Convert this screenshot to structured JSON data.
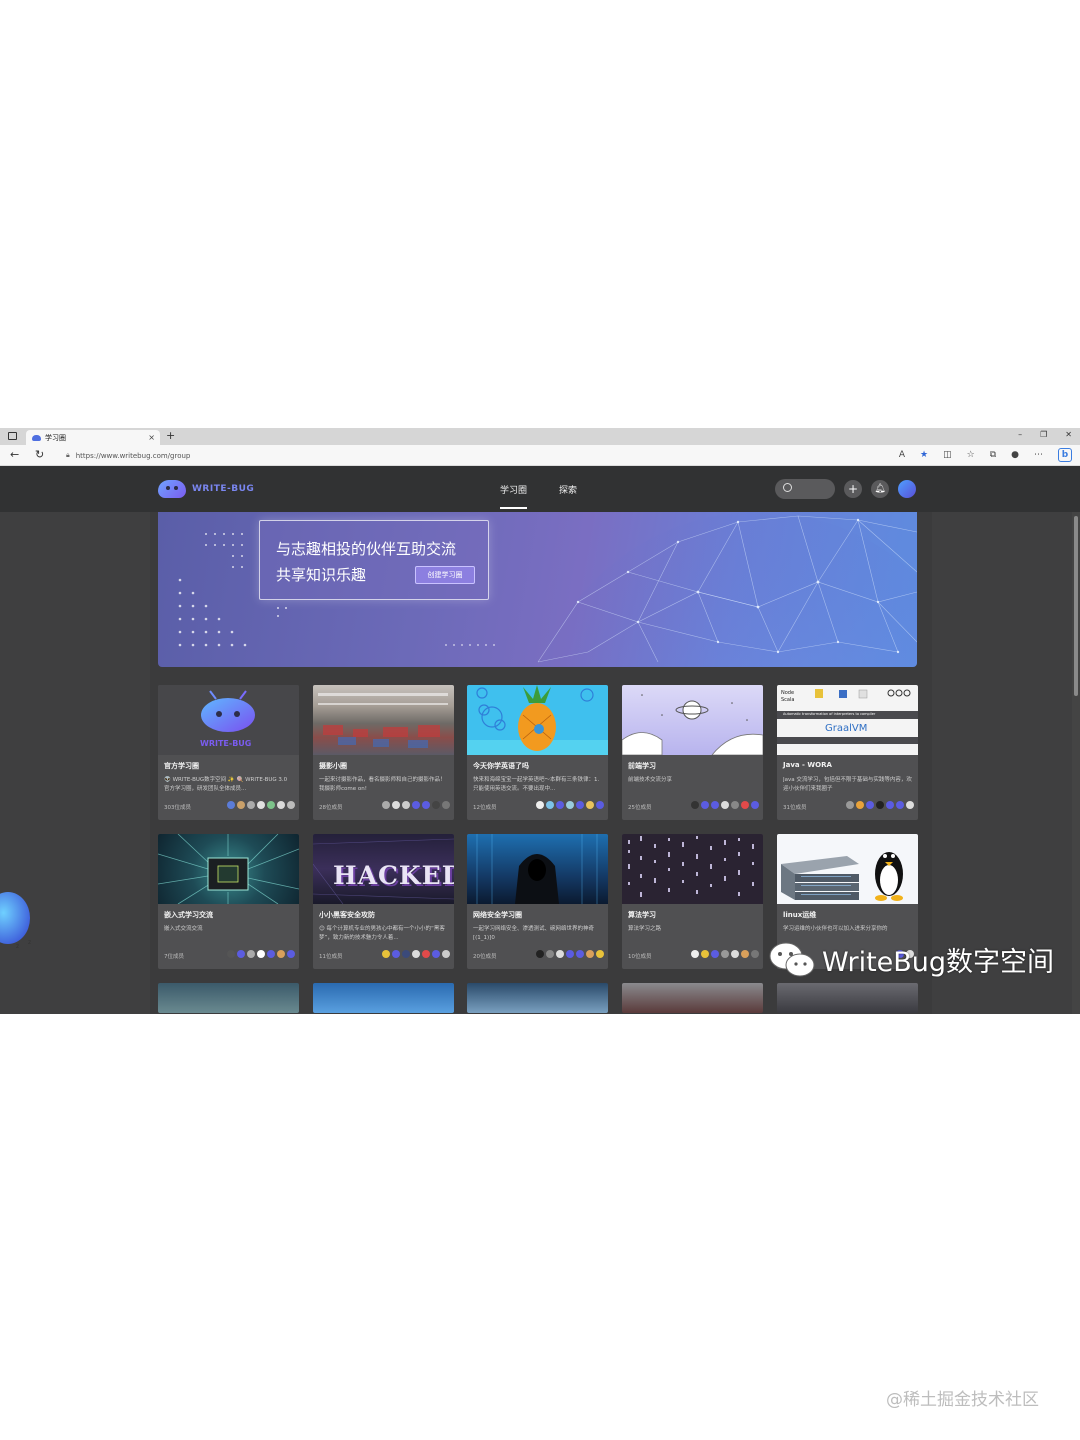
{
  "browser": {
    "tab_title": "学习圈",
    "url": "https://www.writebug.com/group"
  },
  "site": {
    "logo_text": "WRITE-BUG",
    "nav": [
      "学习圈",
      "探索"
    ],
    "accent": "#7a86f0"
  },
  "banner": {
    "line1": "与志趣相投的伙伴互助交流",
    "line2": "共享知识乐趣",
    "button": "创建学习圈"
  },
  "cards": [
    {
      "title": "官方学习圈",
      "desc": "👽 WRITE-BUG数字空间 ✨ 🍭 WRITE-BUG 3.0 官方学习圈，研发团队全体成员...",
      "members": "303位成员"
    },
    {
      "title": "摄影小圈",
      "desc": "一起来讨摄影作品，看名摄影师和自己的摄影作品！我摄影师come on!",
      "members": "28位成员"
    },
    {
      "title": "今天你学英语了吗",
      "desc": "快来和海绵宝宝一起学英语吧～本群有三条铁律：1.只能使用英语交流。不要出现中...",
      "members": "12位成员"
    },
    {
      "title": "前端学习",
      "desc": "前端技术交流分享",
      "members": "25位成员"
    },
    {
      "title": "Java - WORA",
      "desc": "Java 交流学习，包括但不限于基础与实践等内容，欢迎小伙伴们来我圈子",
      "members": "31位成员"
    },
    {
      "title": "嵌入式学习交流",
      "desc": "嵌入式交流交流",
      "members": "7位成员"
    },
    {
      "title": "小小黑客安全攻防",
      "desc": "😊 每个计算机专业的男孩心中都有一个小小的“黑客梦”，致力新的技术魅力令人着...",
      "members": "11位成员"
    },
    {
      "title": "网络安全学习圈",
      "desc": "一起学习网络安全、渗透测试、碗网络世界的神奇[(1_1)]0",
      "members": "20位成员"
    },
    {
      "title": "算法学习",
      "desc": "算法学习之路",
      "members": "10位成员"
    },
    {
      "title": "linux运维",
      "desc": "学习运维的小伙伴也可以加入进来分享你的",
      "members": ""
    }
  ],
  "card_images": {
    "robot_caption": "WRITE-BUG",
    "hacked_text": "HACKED",
    "graalvm_text": "GraalVM",
    "graalvm_caption": "Automatic transformation of interpreters to compiler"
  },
  "watermark": {
    "label": "WriteBug数字空间",
    "credit": "@稀土掘金技术社区"
  }
}
